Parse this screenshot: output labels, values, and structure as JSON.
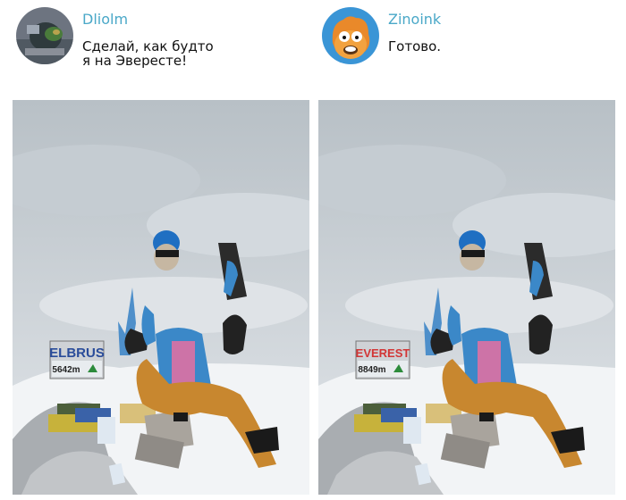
{
  "messages": [
    {
      "author": "Dliolm",
      "text_lines": [
        "Сделай, как будто",
        "я на Эвересте!"
      ]
    },
    {
      "author": "Zinoink",
      "text_lines": [
        "Готово."
      ]
    }
  ],
  "photos": [
    {
      "sign_name": "ELBRUS",
      "sign_height": "5642m"
    },
    {
      "sign_name": "EVEREST",
      "sign_height": "8849m"
    }
  ],
  "colors": {
    "author_name": "#4aa8c8"
  }
}
